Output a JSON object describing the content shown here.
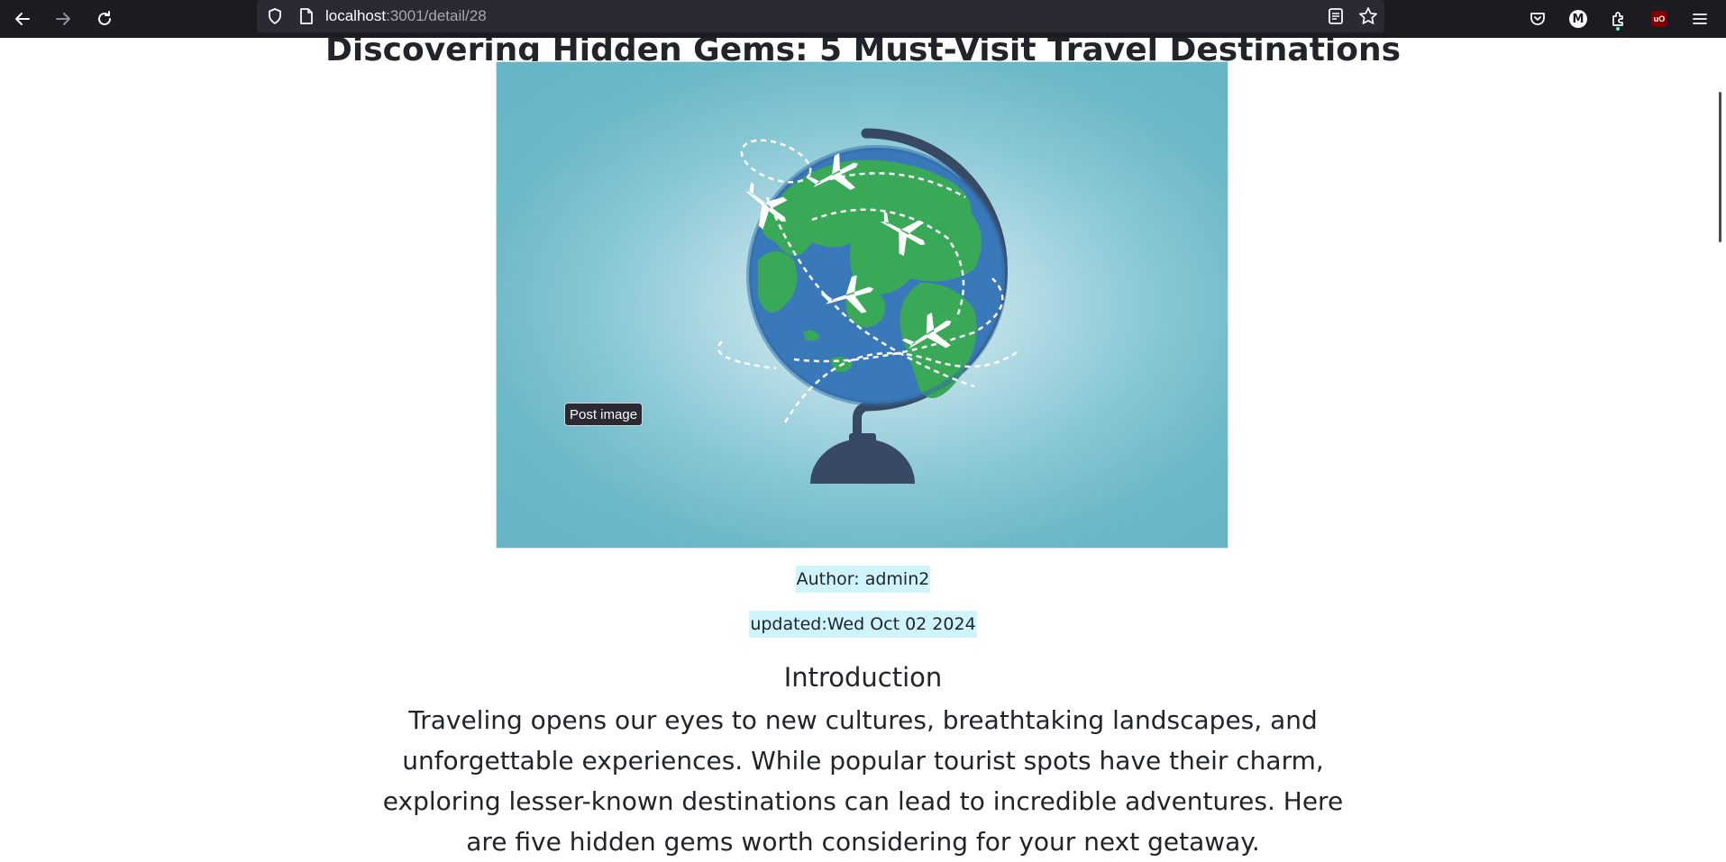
{
  "browser": {
    "url_host": "localhost",
    "url_rest": ":3001/detail/28"
  },
  "post": {
    "title": "Discovering Hidden Gems: 5 Must-Visit Travel Destinations",
    "image_tooltip": "Post image",
    "author_line": "Author: admin2",
    "updated_line": "updated:Wed Oct 02 2024",
    "intro_heading": "Introduction",
    "intro_body": "Traveling opens our eyes to new cultures, breathtaking landscapes, and unforgettable experiences. While popular tourist spots have their charm, exploring lesser-known destinations can lead to incredible adventures. Here are five hidden gems worth considering for your next getaway."
  },
  "colors": {
    "chrome_bg": "#1c1b22",
    "urlbar_bg": "#2b2a33",
    "highlight_bg": "#cff4fc",
    "ocean": "#3a79b9",
    "land": "#3aa957",
    "globe_stand": "#384a63"
  },
  "icons": [
    "back-arrow-icon",
    "forward-arrow-icon",
    "reload-icon",
    "shield-icon",
    "page-icon",
    "reader-view-icon",
    "star-icon",
    "pocket-icon",
    "account-icon",
    "extensions-icon",
    "ublock-icon",
    "menu-icon"
  ]
}
